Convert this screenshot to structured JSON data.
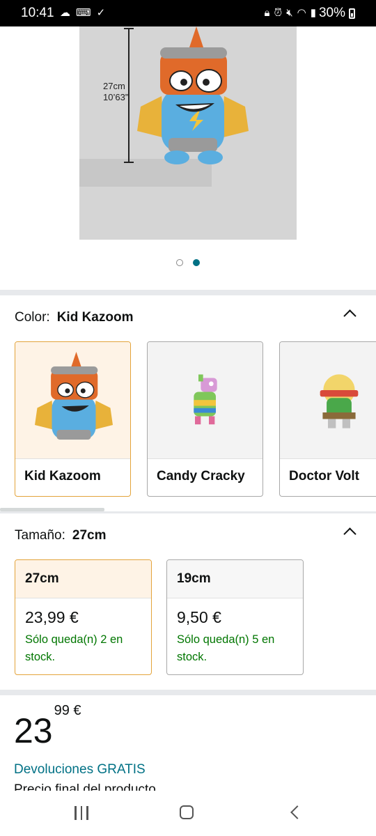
{
  "status_bar": {
    "time": "10:41",
    "battery": "30%"
  },
  "product_image": {
    "dimension_cm": "27cm",
    "dimension_in": "10’63”",
    "carousel_total": 2,
    "carousel_active_index": 1
  },
  "color_section": {
    "label": "Color:",
    "selected_value": "Kid Kazoom",
    "options": [
      {
        "name": "Kid Kazoom",
        "selected": true
      },
      {
        "name": "Candy Cracky",
        "selected": false
      },
      {
        "name": "Doctor Volt",
        "selected": false
      }
    ]
  },
  "size_section": {
    "label": "Tamaño:",
    "selected_value": "27cm",
    "options": [
      {
        "size": "27cm",
        "price": "23,99 €",
        "stock": "Sólo queda(n) 2 en stock.",
        "selected": true
      },
      {
        "size": "19cm",
        "price": "9,50 €",
        "stock": "Sólo queda(n) 5 en stock.",
        "selected": false
      }
    ]
  },
  "price": {
    "whole": "23",
    "fraction": "99 €"
  },
  "returns_link": "Devoluciones GRATIS",
  "cutoff_text": "Precio final del producto",
  "colors": {
    "accent_teal": "#007185",
    "selected_border": "#e3a33a",
    "stock_green": "#007600"
  }
}
